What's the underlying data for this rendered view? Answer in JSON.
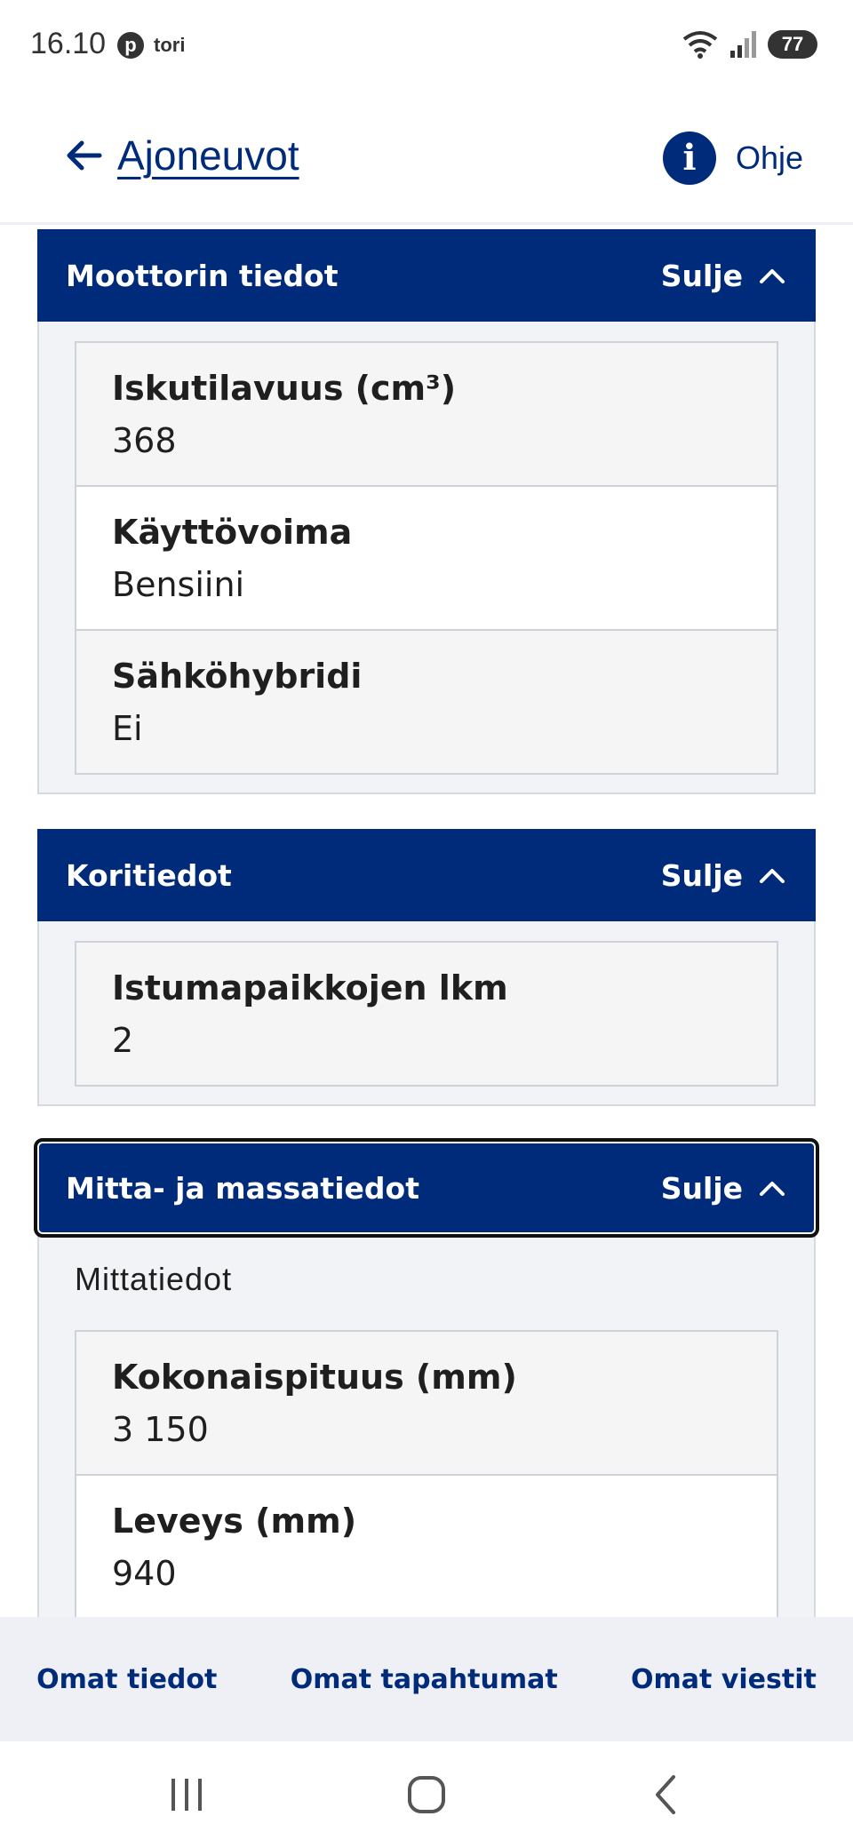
{
  "status_bar": {
    "time": "16.10",
    "app_badge": "p",
    "app_name": "tori",
    "battery": "77"
  },
  "header": {
    "back_label": "Ajoneuvot",
    "help_label": "Ohje",
    "help_icon": "i"
  },
  "sections": [
    {
      "title": "Moottorin tiedot",
      "toggle_label": "Sulje",
      "fields": [
        {
          "label": "Iskutilavuus (cm³)",
          "value": "368"
        },
        {
          "label": "Käyttövoima",
          "value": "Bensiini"
        },
        {
          "label": "Sähköhybridi",
          "value": "Ei"
        }
      ]
    },
    {
      "title": "Koritiedot",
      "toggle_label": "Sulje",
      "fields": [
        {
          "label": "Istumapaikkojen lkm",
          "value": "2"
        }
      ]
    },
    {
      "title": "Mitta- ja massatiedot",
      "toggle_label": "Sulje",
      "subheading": "Mittatiedot",
      "fields": [
        {
          "label": "Kokonaispituus (mm)",
          "value": "3 150"
        },
        {
          "label": "Leveys (mm)",
          "value": "940"
        }
      ]
    }
  ],
  "bottom_nav": {
    "items": [
      "Omat tiedot",
      "Omat tapahtumat",
      "Omat viestit"
    ]
  },
  "colors": {
    "brand": "#002a7a",
    "panel_bg": "#f1f3f6"
  }
}
